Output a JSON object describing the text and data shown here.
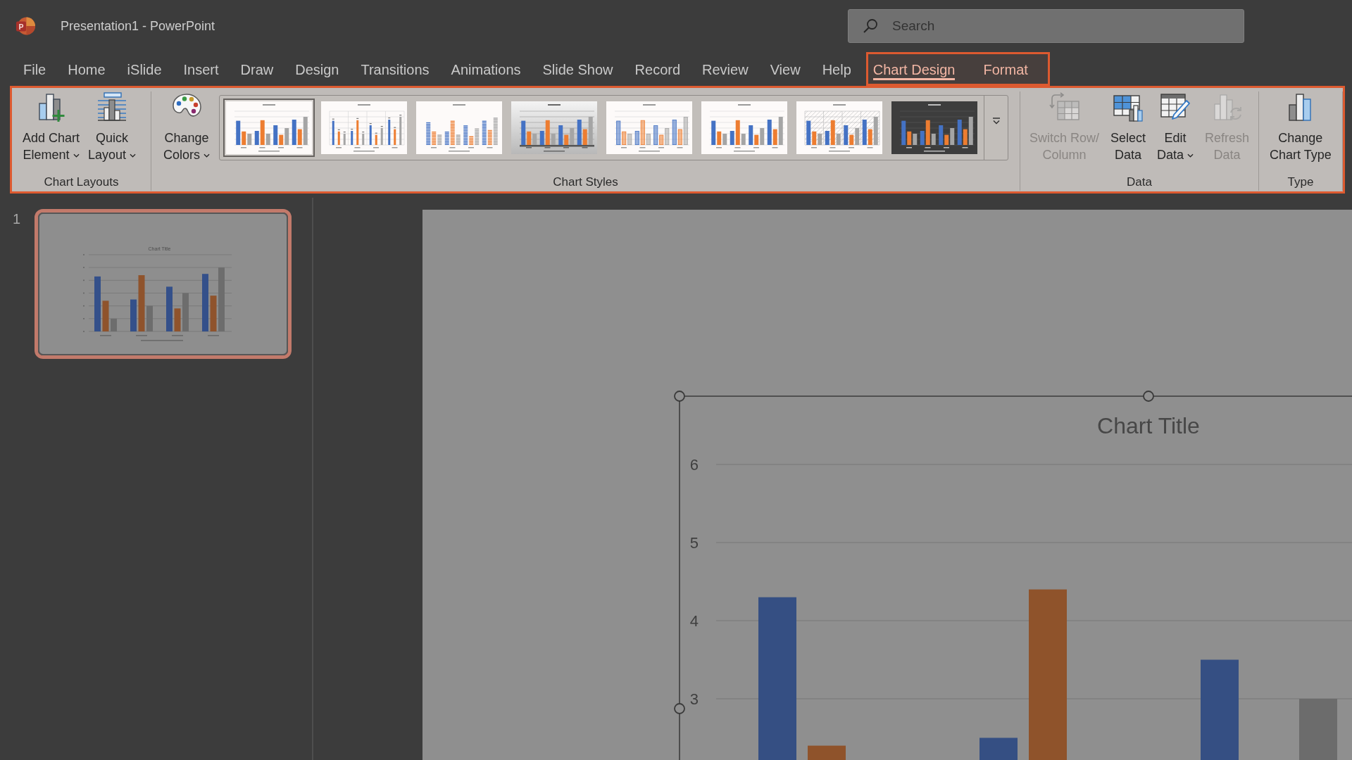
{
  "window": {
    "logo_letter": "P",
    "title": "Presentation1 - PowerPoint"
  },
  "search": {
    "placeholder": "Search"
  },
  "menu": {
    "tabs": [
      {
        "label": "File",
        "selected": false
      },
      {
        "label": "Home",
        "selected": false
      },
      {
        "label": "iSlide",
        "selected": false
      },
      {
        "label": "Insert",
        "selected": false
      },
      {
        "label": "Draw",
        "selected": false
      },
      {
        "label": "Design",
        "selected": false
      },
      {
        "label": "Transitions",
        "selected": false
      },
      {
        "label": "Animations",
        "selected": false
      },
      {
        "label": "Slide Show",
        "selected": false
      },
      {
        "label": "Record",
        "selected": false
      },
      {
        "label": "Review",
        "selected": false
      },
      {
        "label": "View",
        "selected": false
      },
      {
        "label": "Help",
        "selected": false
      }
    ],
    "contextual": {
      "highlighted": true,
      "tabs": [
        {
          "label": "Chart Design",
          "selected": true
        },
        {
          "label": "Format",
          "selected": false
        }
      ]
    }
  },
  "ribbon": {
    "highlighted": true,
    "groups": [
      {
        "label": "Chart Layouts",
        "buttons": [
          {
            "lines": [
              "Add Chart",
              "Element"
            ],
            "dropdown": true,
            "disabled": false
          },
          {
            "lines": [
              "Quick",
              "Layout"
            ],
            "dropdown": true,
            "disabled": false
          }
        ]
      },
      {
        "label": "Chart Styles",
        "buttons": [
          {
            "lines": [
              "Change",
              "Colors"
            ],
            "dropdown": true,
            "disabled": false
          }
        ],
        "gallery": {
          "styles": [
            {
              "kind": "light-grid",
              "selected": true
            },
            {
              "kind": "labeled",
              "selected": false
            },
            {
              "kind": "striped",
              "selected": false
            },
            {
              "kind": "shaded",
              "selected": false
            },
            {
              "kind": "outlined",
              "selected": false
            },
            {
              "kind": "plain",
              "selected": false
            },
            {
              "kind": "hatched",
              "selected": false
            },
            {
              "kind": "dark",
              "selected": false
            }
          ]
        }
      },
      {
        "label": "Data",
        "buttons": [
          {
            "lines": [
              "Switch Row/",
              "Column"
            ],
            "dropdown": false,
            "disabled": true
          },
          {
            "lines": [
              "Select",
              "Data"
            ],
            "dropdown": false,
            "disabled": false
          },
          {
            "lines": [
              "Edit",
              "Data"
            ],
            "dropdown": true,
            "disabled": false
          },
          {
            "lines": [
              "Refresh",
              "Data"
            ],
            "dropdown": false,
            "disabled": true
          }
        ]
      },
      {
        "label": "Type",
        "buttons": [
          {
            "lines": [
              "Change",
              "Chart Type"
            ],
            "dropdown": false,
            "disabled": false
          }
        ]
      }
    ]
  },
  "slides_pane": {
    "slides": [
      {
        "number": "1",
        "selected": true,
        "title": "Chart Title"
      }
    ]
  },
  "slide": {
    "chart": {
      "selected": true,
      "chart_data": {
        "type": "bar",
        "title": "Chart Title",
        "ylim": [
          0,
          6
        ],
        "yticks": [
          3,
          4,
          5,
          6
        ],
        "grid": true,
        "series": [
          {
            "color": "#354f83",
            "values": [
              4.3,
              2.5,
              3.5
            ]
          },
          {
            "color": "#8f532b",
            "values": [
              2.4,
              4.4,
              null
            ]
          },
          {
            "color": "#6c6c6c",
            "values": [
              null,
              null,
              3.0
            ]
          }
        ]
      }
    }
  }
}
